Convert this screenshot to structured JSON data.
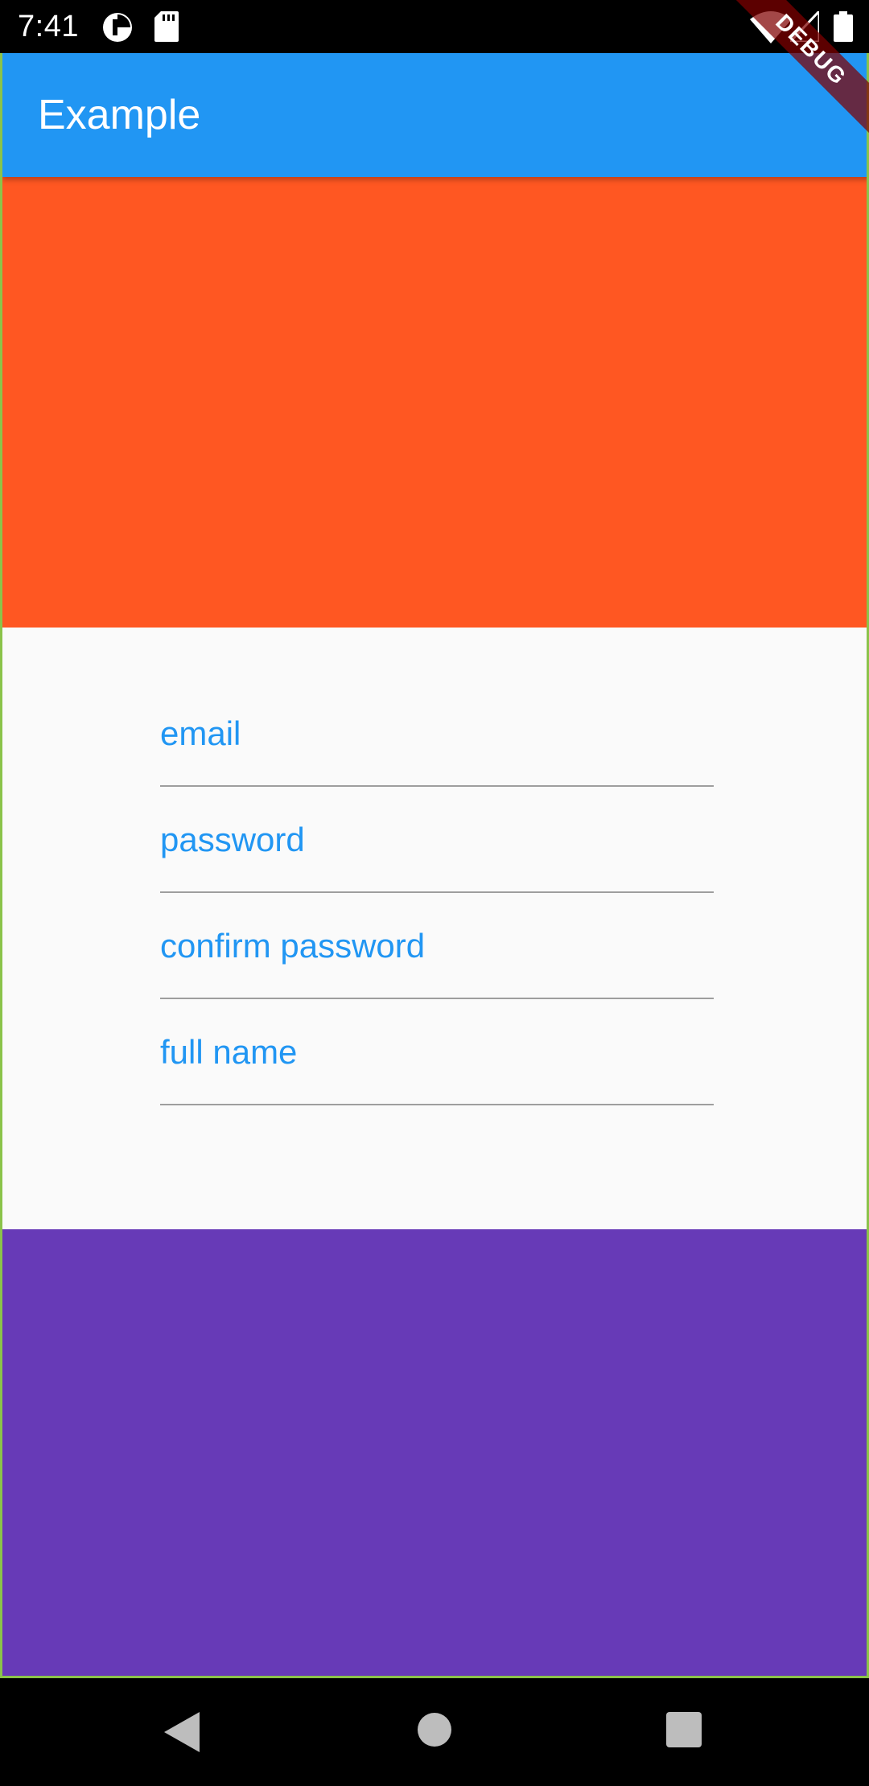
{
  "status_bar": {
    "time": "7:41",
    "icons": [
      "pie-icon",
      "sd-card-icon",
      "wifi-icon",
      "signal-icon",
      "battery-icon"
    ]
  },
  "app_bar": {
    "title": "Example",
    "color": "#2196f3"
  },
  "debug_banner": "DEBUG",
  "top_block": {
    "color": "#ff5722"
  },
  "form": {
    "label_color": "#2196f3",
    "fields": [
      {
        "label": "email"
      },
      {
        "label": "password"
      },
      {
        "label": "confirm password"
      },
      {
        "label": "full name"
      }
    ]
  },
  "bottom_block": {
    "color": "#673ab7"
  },
  "nav_bar": {
    "icons": [
      "back-icon",
      "home-icon",
      "recents-icon"
    ]
  }
}
